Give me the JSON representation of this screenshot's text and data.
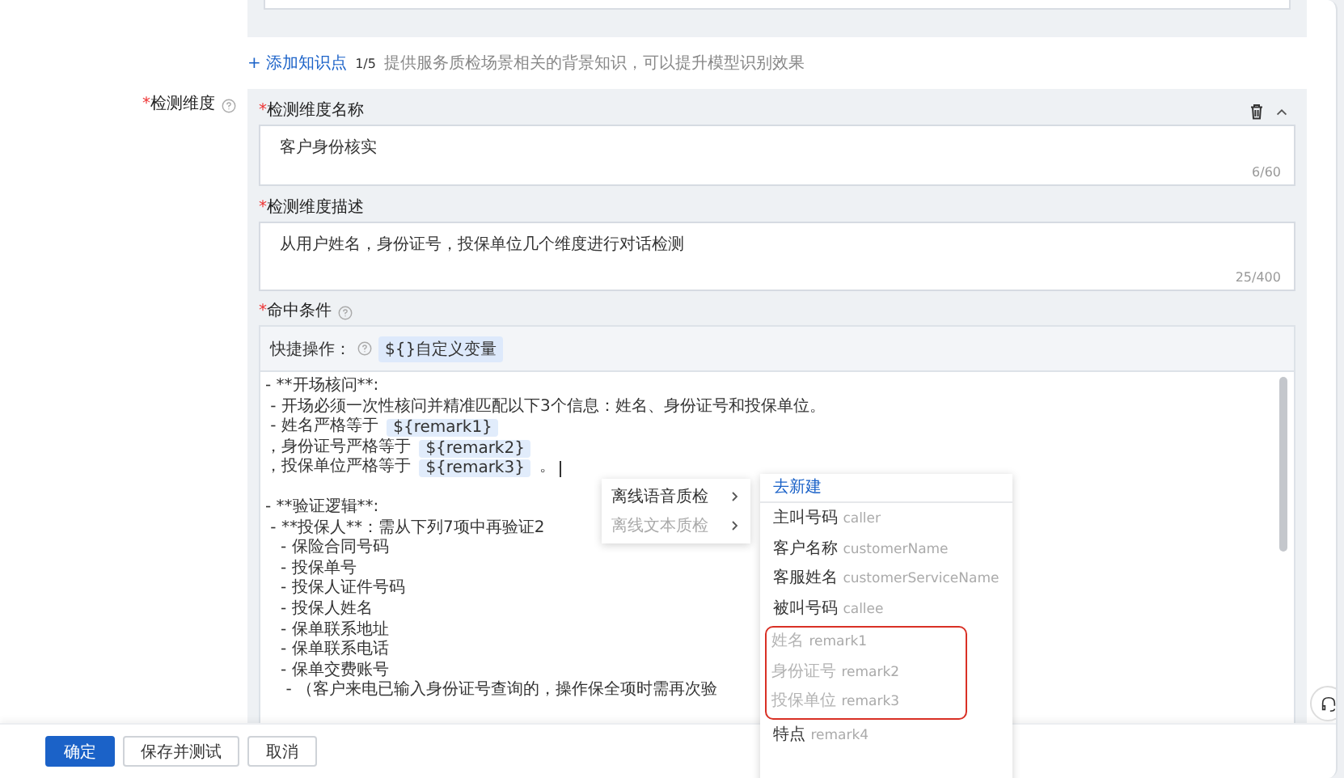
{
  "knowledge": {
    "add_link": "+ 添加知识点",
    "count": "1/5",
    "hint": "提供服务质检场景相关的背景知识，可以提升模型识别效果"
  },
  "dimension": {
    "label": {
      "mark": "*",
      "text": "检测维度"
    }
  },
  "name_field": {
    "label": {
      "mark": "*",
      "text": "检测维度名称"
    },
    "value": "客户身份核实",
    "counter": "6/60"
  },
  "desc_field": {
    "label": {
      "mark": "*",
      "text": "检测维度描述"
    },
    "value": "从用户姓名，身份证号，投保单位几个维度进行对话检测",
    "counter": "25/400"
  },
  "condition": {
    "label": {
      "mark": "*",
      "text": "命中条件"
    },
    "quick_label": "快捷操作：",
    "quick_chip": "${}自定义变量",
    "blocks": [
      {
        "lines": [
          {
            "segments": [
              {
                "kind": "text",
                "text": "- **开场核问**:"
              }
            ]
          },
          {
            "segments": [
              {
                "kind": "text",
                "text": " - 开场必须一次性核问并精准匹配以下3个信息：姓名、身份证号和投保单位。"
              }
            ]
          },
          {
            "segments": [
              {
                "kind": "text",
                "text": " - 姓名严格等于 "
              },
              {
                "kind": "var",
                "text": "${remark1}"
              }
            ]
          },
          {
            "segments": [
              {
                "kind": "text",
                "text": "，身份证号严格等于 "
              },
              {
                "kind": "var",
                "text": "${remark2}"
              }
            ]
          },
          {
            "segments": [
              {
                "kind": "text",
                "text": "，投保单位严格等于 "
              },
              {
                "kind": "var",
                "text": "${remark3}"
              },
              {
                "kind": "text",
                "text": " 。"
              },
              {
                "kind": "cursor"
              }
            ]
          }
        ]
      },
      {
        "lines": [
          {
            "segments": [
              {
                "kind": "text",
                "text": "- **验证逻辑**:"
              }
            ]
          },
          {
            "segments": [
              {
                "kind": "text",
                "text": " - **投保人**：需从下列7项中再验证2"
              }
            ]
          },
          {
            "segments": [
              {
                "kind": "text",
                "text": "   - 保险合同号码"
              }
            ]
          },
          {
            "segments": [
              {
                "kind": "text",
                "text": "   - 投保单号"
              }
            ]
          },
          {
            "segments": [
              {
                "kind": "text",
                "text": "   - 投保人证件号码"
              }
            ]
          },
          {
            "segments": [
              {
                "kind": "text",
                "text": "   - 投保人姓名"
              }
            ]
          },
          {
            "segments": [
              {
                "kind": "text",
                "text": "   - 保单联系地址"
              }
            ]
          },
          {
            "segments": [
              {
                "kind": "text",
                "text": "   - 保单联系电话"
              }
            ]
          },
          {
            "segments": [
              {
                "kind": "text",
                "text": "   - 保单交费账号"
              }
            ]
          },
          {
            "segments": [
              {
                "kind": "text",
                "text": "    - （客户来电已输入身份证号查询的，操作保全项时需再次验"
              }
            ]
          }
        ]
      }
    ]
  },
  "context_menu": {
    "items": [
      {
        "label": "离线语音质检",
        "disabled": false
      },
      {
        "label": "离线文本质检",
        "disabled": true
      }
    ]
  },
  "variable_menu": {
    "create_link": "去新建",
    "items": [
      {
        "name": "主叫号码",
        "field": "caller",
        "disabled": false,
        "highlighted": false
      },
      {
        "name": "客户名称",
        "field": "customerName",
        "disabled": false,
        "highlighted": false
      },
      {
        "name": "客服姓名",
        "field": "customerServiceName",
        "disabled": false,
        "highlighted": false
      },
      {
        "name": "被叫号码",
        "field": "callee",
        "disabled": false,
        "highlighted": false
      },
      {
        "name": "姓名",
        "field": "remark1",
        "disabled": true,
        "highlighted": true
      },
      {
        "name": "身份证号",
        "field": "remark2",
        "disabled": true,
        "highlighted": true
      },
      {
        "name": "投保单位",
        "field": "remark3",
        "disabled": true,
        "highlighted": true
      },
      {
        "name": "特点",
        "field": "remark4",
        "disabled": false,
        "highlighted": false
      }
    ]
  },
  "buttons": [
    {
      "label": "确定",
      "kind": "primary"
    },
    {
      "label": "保存并测试",
      "kind": "default"
    },
    {
      "label": "取消",
      "kind": "default"
    }
  ]
}
